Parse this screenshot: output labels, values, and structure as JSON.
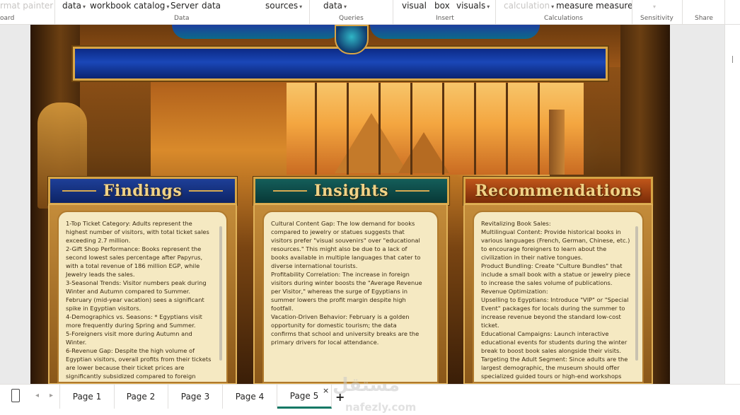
{
  "ribbon": {
    "items": [
      {
        "label": "rmat painter",
        "disabled": true,
        "caret": false
      },
      {
        "label": "data",
        "caret": true
      },
      {
        "label": "workbook catalog",
        "caret": true
      },
      {
        "label": "Server",
        "caret": false
      },
      {
        "label": "data",
        "caret": false
      },
      {
        "label": "sources",
        "caret": true
      },
      {
        "label": "data",
        "caret": true
      },
      {
        "label": "visual",
        "caret": false
      },
      {
        "label": "box",
        "caret": false
      },
      {
        "label": "visuals",
        "caret": true
      },
      {
        "label": "calculation",
        "disabled": true,
        "caret": true
      },
      {
        "label": "measure measure",
        "caret": false
      }
    ],
    "groups": [
      "oard",
      "Data",
      "Queries",
      "Insert",
      "Calculations",
      "Sensitivity",
      "Share"
    ]
  },
  "panels": [
    {
      "title": "Findings",
      "header_color": "#1b3a8c",
      "lines": [
        "1-Top Ticket Category: Adults represent the",
        "highest number of visitors, with total ticket sales",
        "exceeding 2.7 million.",
        "2-Gift Shop Performance: Books represent the",
        "second lowest sales percentage after Papyrus,",
        "with a total revenue of 186 million EGP, while",
        "Jewelry leads the sales.",
        "3-Seasonal Trends: Visitor numbers peak during",
        "Winter and Autumn compared to Summer.",
        "February (mid-year vacation) sees a significant",
        "spike in Egyptian visitors.",
        "4-Demographics vs. Seasons: * Egyptians visit",
        "more frequently during Spring and Summer.",
        "5-Foreigners visit more during Autumn and",
        "Winter.",
        "6-Revenue Gap: Despite the high volume of",
        "Egyptian visitors, overall profits from their tickets",
        "are lower because their ticket prices are",
        "significantly subsidized compared to foreign"
      ]
    },
    {
      "title": "Insights",
      "header_color": "#0f4a48",
      "lines": [
        "Cultural Content Gap: The low demand for books",
        "compared to jewelry or statues suggests that",
        "visitors prefer \"visual souvenirs\" over \"educational",
        "resources.\" This might also be due to a lack of",
        "books available in multiple languages that cater to",
        "diverse international tourists.",
        "Profitability Correlation: The increase in foreign",
        "visitors during winter boosts the \"Average Revenue",
        "per Visitor,\" whereas the surge of Egyptians in",
        "summer lowers the profit margin despite high",
        "footfall.",
        "Vacation-Driven Behavior: February is a golden",
        "opportunity for domestic tourism; the data",
        "confirms that school and university breaks are the",
        "primary drivers for local attendance."
      ]
    },
    {
      "title": "Recommendations",
      "header_color": "#a8430f",
      "lines": [
        "Revitalizing Book Sales:",
        "Multilingual Content: Provide historical books in",
        "various languages (French, German, Chinese, etc.)",
        "to encourage foreigners to learn about the",
        "civilization in their native tongues.",
        "Product Bundling: Create \"Culture Bundles\" that",
        "include a small book with a statue or jewelry piece",
        "to increase the sales volume of publications.",
        "Revenue Optimization:",
        "Upselling to Egyptians: Introduce \"VIP\" or \"Special",
        "Event\" packages for locals during the summer to",
        "increase revenue beyond the standard low-cost",
        "ticket.",
        "Educational Campaigns: Launch interactive",
        "educational events for students during the winter",
        "break to boost book sales alongside their visits.",
        "Targeting the Adult Segment: Since adults are the",
        "largest demographic, the museum should offer",
        "specialized guided tours or high-end workshops"
      ]
    }
  ],
  "tabs": [
    "Page 1",
    "Page 2",
    "Page 3",
    "Page 4",
    "Page 5"
  ],
  "active_tab": "Page 5",
  "watermark": {
    "arabic": "مستقل",
    "latin": "nafezly.com"
  },
  "colors": {
    "accent": "#117865",
    "gold": "#d6a445"
  }
}
